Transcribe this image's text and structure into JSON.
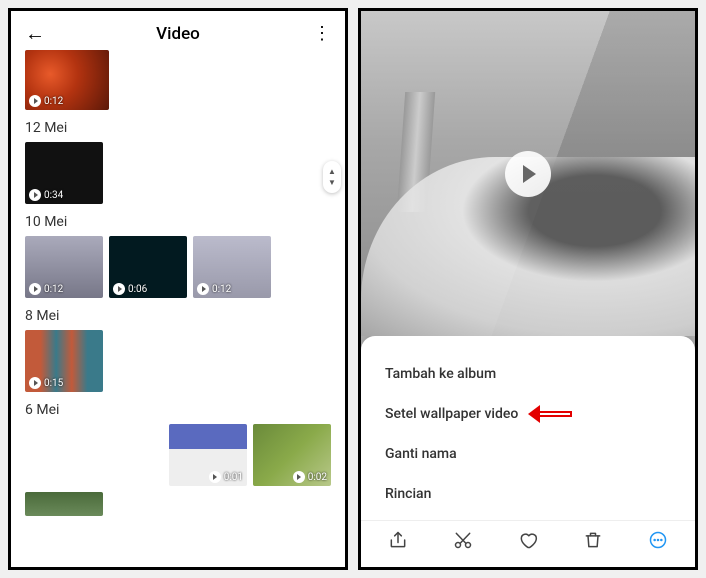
{
  "left": {
    "title": "Video",
    "sections": [
      {
        "thumbs": [
          {
            "duration": "0:12"
          }
        ]
      },
      {
        "date": "12 Mei",
        "thumbs": [
          {
            "duration": "0:34"
          }
        ]
      },
      {
        "date": "10 Mei",
        "thumbs": [
          {
            "duration": "0:12"
          },
          {
            "duration": "0:06"
          },
          {
            "duration": "0:12"
          }
        ]
      },
      {
        "date": "8 Mei",
        "thumbs": [
          {
            "duration": "0:15"
          }
        ]
      },
      {
        "date": "6 Mei",
        "thumbs": [
          {
            "duration": "0:01"
          },
          {
            "duration": "0:02"
          }
        ]
      }
    ]
  },
  "right": {
    "sheet": {
      "items": [
        {
          "label": "Tambah ke album"
        },
        {
          "label": "Setel wallpaper video",
          "highlight": true
        },
        {
          "label": "Ganti nama"
        },
        {
          "label": "Rincian"
        }
      ]
    },
    "toolbar": {
      "share": "share-icon",
      "cut": "cut-icon",
      "like": "heart-icon",
      "delete": "trash-icon",
      "more": "more-icon"
    }
  }
}
